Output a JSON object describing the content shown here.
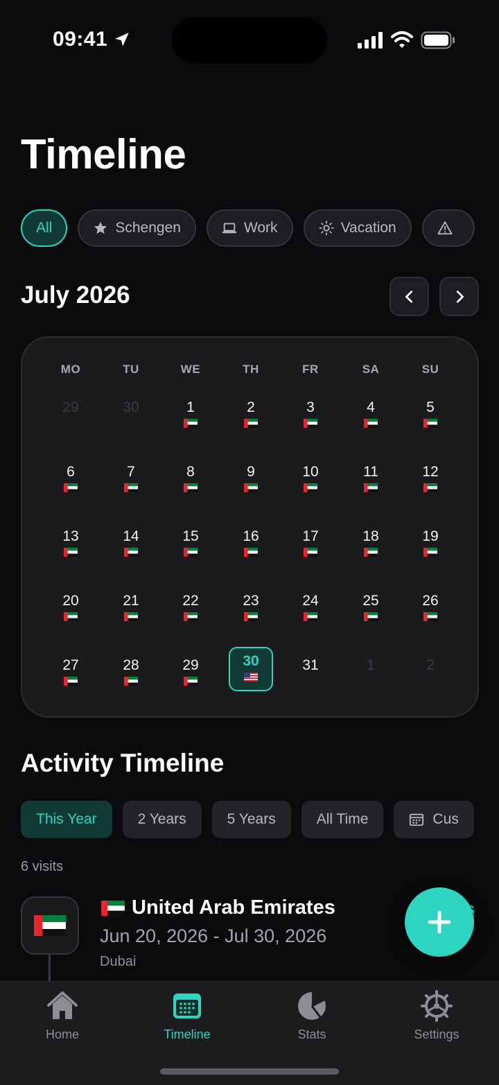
{
  "status_bar": {
    "time": "09:41"
  },
  "page_title": "Timeline",
  "filters": [
    {
      "label": "All",
      "icon": "",
      "active": true
    },
    {
      "label": "Schengen",
      "icon": "star-icon",
      "active": false
    },
    {
      "label": "Work",
      "icon": "laptop-icon",
      "active": false
    },
    {
      "label": "Vacation",
      "icon": "sun-icon",
      "active": false
    },
    {
      "label": "",
      "icon": "warning-icon",
      "active": false
    }
  ],
  "calendar": {
    "month_title": "July 2026",
    "weekdays": [
      "MO",
      "TU",
      "WE",
      "TH",
      "FR",
      "SA",
      "SU"
    ],
    "weeks": [
      [
        {
          "d": "29",
          "m": true,
          "f": ""
        },
        {
          "d": "30",
          "m": true,
          "f": ""
        },
        {
          "d": "1",
          "m": false,
          "f": "ae"
        },
        {
          "d": "2",
          "m": false,
          "f": "ae"
        },
        {
          "d": "3",
          "m": false,
          "f": "ae"
        },
        {
          "d": "4",
          "m": false,
          "f": "ae"
        },
        {
          "d": "5",
          "m": false,
          "f": "ae"
        }
      ],
      [
        {
          "d": "6",
          "m": false,
          "f": "ae"
        },
        {
          "d": "7",
          "m": false,
          "f": "ae"
        },
        {
          "d": "8",
          "m": false,
          "f": "ae"
        },
        {
          "d": "9",
          "m": false,
          "f": "ae"
        },
        {
          "d": "10",
          "m": false,
          "f": "ae"
        },
        {
          "d": "11",
          "m": false,
          "f": "ae"
        },
        {
          "d": "12",
          "m": false,
          "f": "ae"
        }
      ],
      [
        {
          "d": "13",
          "m": false,
          "f": "ae"
        },
        {
          "d": "14",
          "m": false,
          "f": "ae"
        },
        {
          "d": "15",
          "m": false,
          "f": "ae"
        },
        {
          "d": "16",
          "m": false,
          "f": "ae"
        },
        {
          "d": "17",
          "m": false,
          "f": "ae"
        },
        {
          "d": "18",
          "m": false,
          "f": "ae"
        },
        {
          "d": "19",
          "m": false,
          "f": "ae"
        }
      ],
      [
        {
          "d": "20",
          "m": false,
          "f": "ae"
        },
        {
          "d": "21",
          "m": false,
          "f": "ae"
        },
        {
          "d": "22",
          "m": false,
          "f": "ae"
        },
        {
          "d": "23",
          "m": false,
          "f": "ae"
        },
        {
          "d": "24",
          "m": false,
          "f": "ae"
        },
        {
          "d": "25",
          "m": false,
          "f": "ae"
        },
        {
          "d": "26",
          "m": false,
          "f": "ae"
        }
      ],
      [
        {
          "d": "27",
          "m": false,
          "f": "ae"
        },
        {
          "d": "28",
          "m": false,
          "f": "ae"
        },
        {
          "d": "29",
          "m": false,
          "f": "ae"
        },
        {
          "d": "30",
          "m": false,
          "f": "us",
          "today": true
        },
        {
          "d": "31",
          "m": false,
          "f": ""
        },
        {
          "d": "1",
          "m": true,
          "f": ""
        },
        {
          "d": "2",
          "m": true,
          "f": ""
        }
      ]
    ]
  },
  "activity": {
    "title": "Activity Timeline",
    "ranges": [
      {
        "label": "This Year",
        "active": true
      },
      {
        "label": "2 Years",
        "active": false
      },
      {
        "label": "5 Years",
        "active": false
      },
      {
        "label": "All Time",
        "active": false
      },
      {
        "label": "Cus",
        "icon": "calendar-icon",
        "active": false
      }
    ],
    "visits_count": "6 visits",
    "visit": {
      "country": "United Arab Emirates",
      "dates": "Jun 20, 2026 - Jul 30, 2026",
      "city": "Dubai",
      "tag": "s"
    }
  },
  "tabs": [
    {
      "label": "Home",
      "icon": "home-icon",
      "active": false
    },
    {
      "label": "Timeline",
      "icon": "calendar-grid-icon",
      "active": true
    },
    {
      "label": "Stats",
      "icon": "pie-chart-icon",
      "active": false
    },
    {
      "label": "Settings",
      "icon": "gear-icon",
      "active": false
    }
  ],
  "colors": {
    "accent": "#2dd4bf",
    "background": "#0b0b0d",
    "surface": "#1b1b1e"
  }
}
